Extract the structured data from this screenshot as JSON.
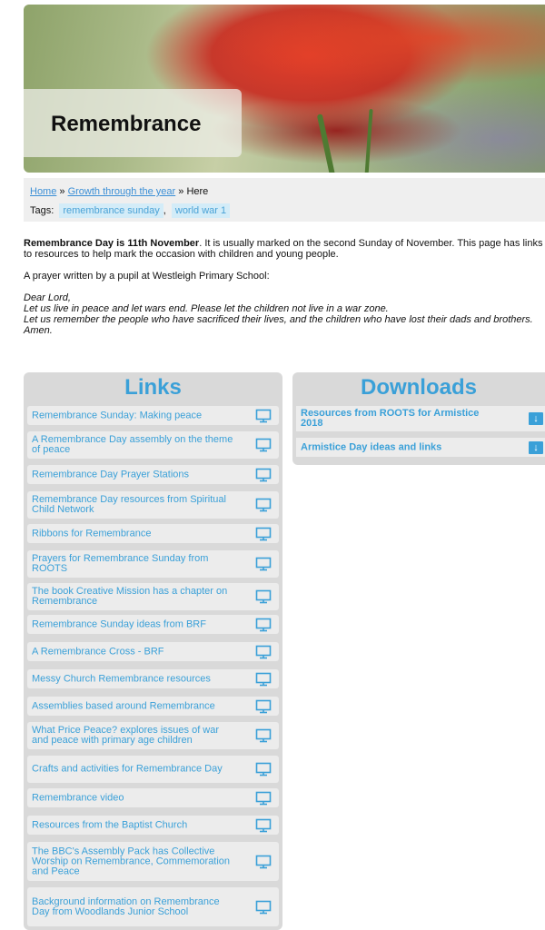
{
  "hero": {
    "title": "Remembrance"
  },
  "breadcrumb": {
    "home": "Home",
    "sep1": " » ",
    "section": "Growth through the year",
    "sep2": " » ",
    "current": "Here"
  },
  "tags": {
    "label": "Tags:",
    "items": [
      "remembrance sunday",
      "world war 1"
    ],
    "sep": ","
  },
  "intro": {
    "bold_lead": "Remembrance Day is 11th November",
    "rest": ". It is usually marked on the second Sunday of November. This page has links to resources to help mark the occasion with children and young people.",
    "prayer_intro": "A prayer written by a pupil at Westleigh Primary School:",
    "prayer_lines": [
      "Dear Lord,",
      "Let us live in peace and let wars end. Please let the children not live in a war zone.",
      "Let us remember the people who have sacrificed their lives, and the children who have lost their dads and brothers.",
      "Amen."
    ]
  },
  "links": {
    "title": "Links",
    "icon": "monitor-icon",
    "items": [
      "Remembrance Sunday: Making peace",
      "A Remembrance Day assembly on the theme of peace",
      "Remembrance Day Prayer Stations",
      "Remembrance Day resources from Spiritual Child Network",
      "Ribbons for Remembrance",
      "Prayers for Remembrance Sunday from ROOTS",
      "The book Creative Mission has a chapter on Remembrance",
      "Remembrance Sunday ideas from BRF",
      "A Remembrance Cross - BRF",
      "Messy Church Remembrance resources",
      "Assemblies based around Remembrance",
      "What Price Peace? explores issues of war and peace with primary age children",
      "Crafts and activities for Remembrance Day",
      "Remembrance video",
      "Resources from the Baptist Church",
      "The BBC's Assembly Pack has Collective Worship on Remembrance, Commemoration and Peace",
      "Background information on Remembrance Day from Woodlands Junior School"
    ]
  },
  "downloads": {
    "title": "Downloads",
    "icon": "download-icon",
    "items": [
      "Resources from ROOTS for Armistice 2018",
      "Armistice Day ideas and links"
    ]
  },
  "colors": {
    "accent": "#3aa0d8",
    "panel": "#d9d9d9",
    "item": "#ececec",
    "tag_bg": "#d3ecf8"
  }
}
